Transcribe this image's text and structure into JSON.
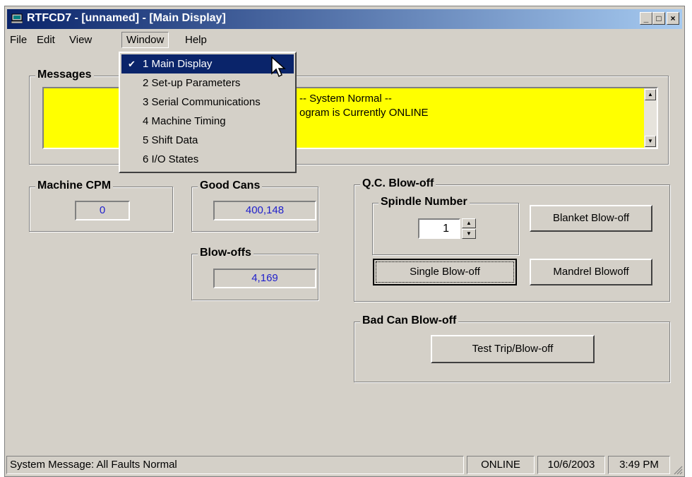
{
  "window": {
    "title": "RTFCD7 - [unnamed] - [Main Display]",
    "minimize": "_",
    "maximize": "□",
    "close": "×"
  },
  "menu": [
    "File",
    "Edit",
    "View",
    "Window",
    "Help"
  ],
  "window_menu": {
    "items": [
      "1 Main Display",
      "2 Set-up Parameters",
      "3 Serial Communications",
      "4 Machine Timing",
      "5 Shift Data",
      "6 I/O States"
    ],
    "checked": "✔"
  },
  "messages": {
    "label": "Messages",
    "line1": "-- System Normal --",
    "line2": "ogram is Currently ONLINE",
    "bg_color": "#ffff00"
  },
  "machine_cpm": {
    "label": "Machine CPM",
    "value": "0"
  },
  "good_cans": {
    "label": "Good Cans",
    "value": "400,148"
  },
  "blow_offs": {
    "label": "Blow-offs",
    "value": "4,169"
  },
  "qc_blowoff": {
    "label": "Q.C. Blow-off",
    "spindle_label": "Spindle Number",
    "spindle_value": "1",
    "blanket_btn": "Blanket Blow-off",
    "single_btn": "Single Blow-off",
    "mandrel_btn": "Mandrel Blowoff"
  },
  "bad_can": {
    "label": "Bad Can Blow-off",
    "test_btn": "Test Trip/Blow-off"
  },
  "status": {
    "message": "System Message:  All Faults Normal",
    "state": "ONLINE",
    "date": "10/6/2003",
    "time": "3:49 PM"
  },
  "value_color": "#1f1fcc"
}
